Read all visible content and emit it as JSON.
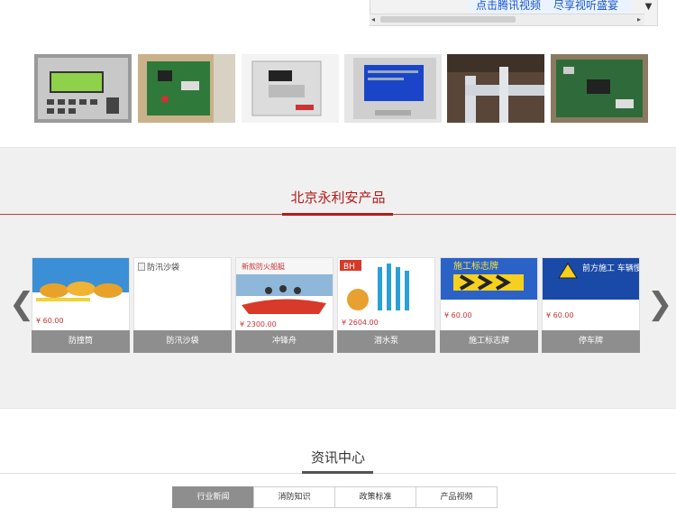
{
  "video": {
    "banner_left": "点击腾讯视频",
    "banner_right": "尽享视听盛宴",
    "scroll_down_glyph": "▼",
    "scroll_left_glyph": "◂",
    "scroll_right_glyph": "▸"
  },
  "photos": [
    "controller-panel-photo",
    "circuit-board-photo",
    "control-box-photo",
    "blue-screen-panel-photo",
    "pipe-installation-photo",
    "circuit-board-closeup-photo"
  ],
  "products": {
    "title": "北京永利安产品",
    "prev_glyph": "❮",
    "next_glyph": "❯",
    "items": [
      {
        "label": "防撞筒",
        "price": "¥ 60.00"
      },
      {
        "label": "防汛沙袋",
        "alt": "防汛沙袋"
      },
      {
        "label": "冲锋舟",
        "price": "¥ 2300.00",
        "banner": "新款防火船艇"
      },
      {
        "label": "潜水泵",
        "price": "¥ 2604.00",
        "brand": "BH"
      },
      {
        "label": "施工标志牌",
        "price": "¥ 60.00",
        "banner": "施工标志牌"
      },
      {
        "label": "停车牌",
        "price": "¥ 60.00",
        "banner": "前方施工 车辆慢行"
      }
    ]
  },
  "news": {
    "title": "资讯中心",
    "tabs": [
      "行业新闻",
      "消防知识",
      "政策标准",
      "产品视频"
    ]
  },
  "colors": {
    "accent_red": "#b31a1a",
    "tab_active": "#8e8e8e",
    "section_bg": "#f0f0f0"
  }
}
